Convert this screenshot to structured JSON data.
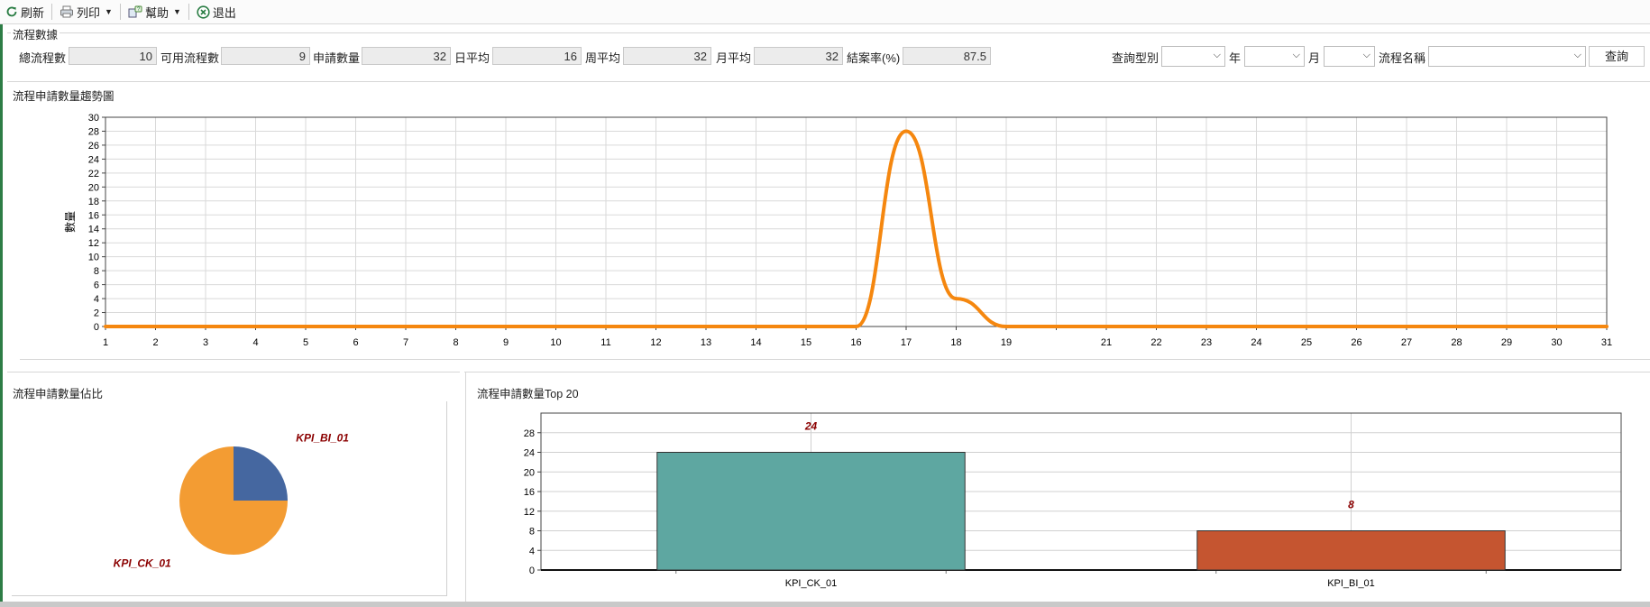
{
  "toolbar": {
    "refresh": "刷新",
    "print": "列印",
    "help": "幫助",
    "exit": "退出"
  },
  "stats": {
    "title": "流程數據",
    "total_flows_label": "總流程數",
    "total_flows": "10",
    "available_flows_label": "可用流程數",
    "available_flows": "9",
    "applications_label": "申請數量",
    "applications": "32",
    "daily_avg_label": "日平均",
    "daily_avg": "16",
    "weekly_avg_label": "周平均",
    "weekly_avg": "32",
    "monthly_avg_label": "月平均",
    "monthly_avg": "32",
    "close_rate_label": "結案率(%)",
    "close_rate": "87.5"
  },
  "query": {
    "type_label": "查詢型別",
    "type_value": "",
    "year_label": "年",
    "year_value": "",
    "month_label": "月",
    "month_value": "",
    "flow_name_label": "流程名稱",
    "flow_name_value": "",
    "button": "查詢"
  },
  "trend": {
    "title": "流程申請數量趨勢圖",
    "ylabel": "數量"
  },
  "ratio": {
    "title": "流程申請數量佔比"
  },
  "top20": {
    "title": "流程申請數量Top 20"
  },
  "colors": {
    "line": "#f5870f",
    "pie_bi": "#4567a0",
    "pie_ck": "#f39c33",
    "bar_ck": "#5ea7a1",
    "bar_bi": "#c55530",
    "data_label": "#8b0000"
  },
  "chart_data": [
    {
      "type": "line",
      "title": "",
      "xlabel": "",
      "ylabel": "數量",
      "x": [
        1,
        2,
        3,
        4,
        5,
        6,
        7,
        8,
        9,
        10,
        11,
        12,
        13,
        14,
        15,
        16,
        17,
        18,
        19,
        20,
        21,
        22,
        23,
        24,
        25,
        26,
        27,
        28,
        29,
        30,
        31
      ],
      "x_ticks": [
        "1",
        "2",
        "3",
        "4",
        "5",
        "6",
        "7",
        "8",
        "9",
        "10",
        "11",
        "12",
        "13",
        "14",
        "15",
        "16",
        "17",
        "18",
        "19",
        "",
        "21",
        "22",
        "23",
        "24",
        "25",
        "26",
        "27",
        "28",
        "29",
        "30",
        "31"
      ],
      "series": [
        {
          "values": [
            0,
            0,
            0,
            0,
            0,
            0,
            0,
            0,
            0,
            0,
            0,
            0,
            0,
            0,
            0,
            0,
            28,
            4,
            0,
            0,
            0,
            0,
            0,
            0,
            0,
            0,
            0,
            0,
            0,
            0,
            0
          ]
        }
      ],
      "ylim": [
        0,
        30
      ],
      "y_ticks": [
        0,
        2,
        4,
        6,
        8,
        10,
        12,
        14,
        16,
        18,
        20,
        22,
        24,
        26,
        28,
        30
      ],
      "grid": true
    },
    {
      "type": "pie",
      "title": "",
      "slices": [
        {
          "label": "KPI_BI_01",
          "value": 8
        },
        {
          "label": "KPI_CK_01",
          "value": 24
        }
      ]
    },
    {
      "type": "bar",
      "title": "",
      "categories": [
        "KPI_CK_01",
        "KPI_BI_01"
      ],
      "values": [
        24,
        8
      ],
      "data_labels": [
        "24",
        "8"
      ],
      "ylim": [
        0,
        32
      ],
      "y_ticks": [
        0,
        4,
        8,
        12,
        16,
        20,
        24,
        28
      ],
      "grid": true
    }
  ]
}
